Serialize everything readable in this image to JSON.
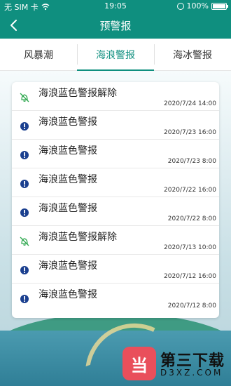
{
  "status": {
    "carrier": "无 SIM 卡",
    "time": "19:05",
    "battery": "100%"
  },
  "nav": {
    "title": "预警报"
  },
  "tabs": [
    {
      "label": "风暴潮"
    },
    {
      "label": "海浪警报"
    },
    {
      "label": "海冰警报"
    }
  ],
  "active_tab": "海浪警报",
  "alerts": [
    {
      "title": "海浪蓝色警报解除",
      "time": "2020/7/24 14:00",
      "icon": "alert-off-icon"
    },
    {
      "title": "海浪蓝色警报",
      "time": "2020/7/23 16:00",
      "icon": "exclamation-icon"
    },
    {
      "title": "海浪蓝色警报",
      "time": "2020/7/23 8:00",
      "icon": "exclamation-icon"
    },
    {
      "title": "海浪蓝色警报",
      "time": "2020/7/22 16:00",
      "icon": "exclamation-icon"
    },
    {
      "title": "海浪蓝色警报",
      "time": "2020/7/22 8:00",
      "icon": "exclamation-icon"
    },
    {
      "title": "海浪蓝色警报解除",
      "time": "2020/7/13 10:00",
      "icon": "alert-off-icon"
    },
    {
      "title": "海浪蓝色警报",
      "time": "2020/7/12 16:00",
      "icon": "exclamation-icon"
    },
    {
      "title": "海浪蓝色警报",
      "time": "2020/7/12 8:00",
      "icon": "exclamation-icon"
    }
  ],
  "watermark": {
    "logo_char": "当",
    "name": "第三下载",
    "domain": "D3XZ.COM"
  },
  "colors": {
    "header": "#0f8f7f",
    "active_tab": "#0f8f7f",
    "alert_icon": "#1a3f8f",
    "release_icon": "#2fa84f"
  }
}
